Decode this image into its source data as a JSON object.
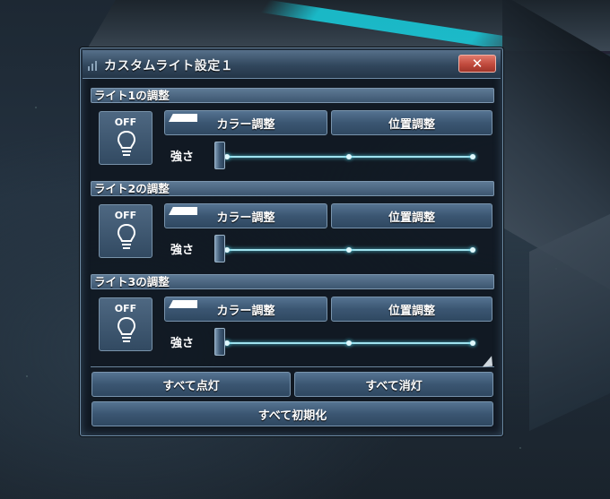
{
  "window": {
    "title": "カスタムライト設定１",
    "close_label": "✕"
  },
  "lights": [
    {
      "header": "ライト1の調整",
      "toggle": "OFF",
      "color_button": "カラー調整",
      "position_button": "位置調整",
      "strength_label": "強さ",
      "strength_level": 0
    },
    {
      "header": "ライト2の調整",
      "toggle": "OFF",
      "color_button": "カラー調整",
      "position_button": "位置調整",
      "strength_label": "強さ",
      "strength_level": 0
    },
    {
      "header": "ライト3の調整",
      "toggle": "OFF",
      "color_button": "カラー調整",
      "position_button": "位置調整",
      "strength_label": "強さ",
      "strength_level": 0
    }
  ],
  "footer": {
    "all_on": "すべて点灯",
    "all_off": "すべて消灯",
    "reset_all": "すべて初期化"
  },
  "colors": {
    "accent": "#19c7d6",
    "close": "#c04a3d",
    "panel": "#101821"
  },
  "icons": {
    "toggle": "lightbulb-icon",
    "close": "close-icon"
  }
}
